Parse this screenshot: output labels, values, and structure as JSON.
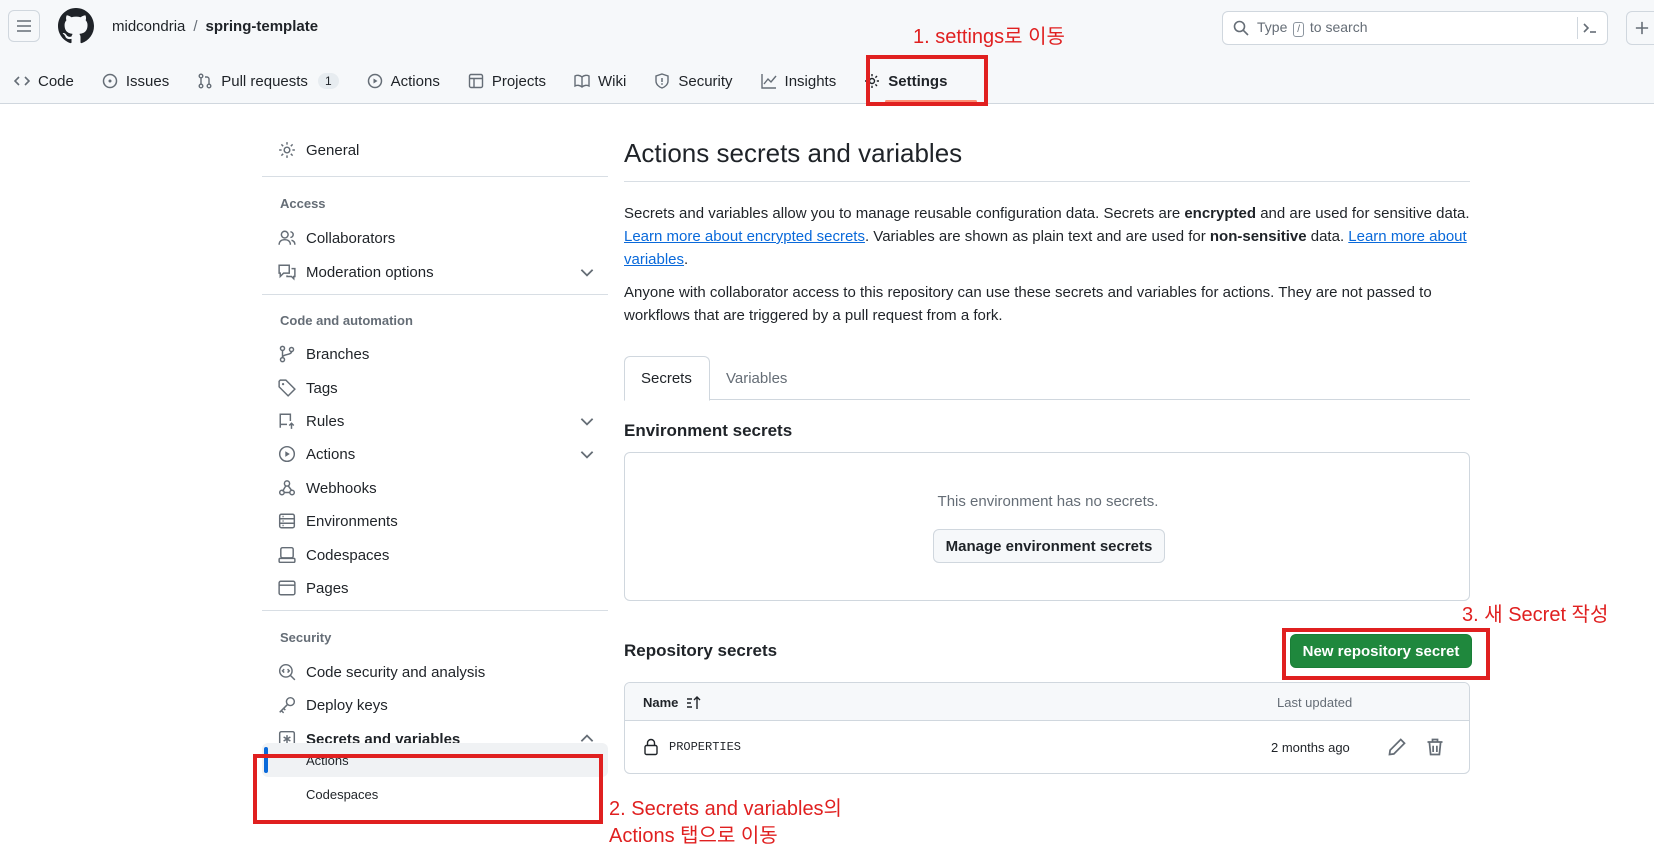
{
  "header": {
    "owner": "midcondria",
    "separator": "/",
    "repo": "spring-template",
    "search_before": "Type",
    "search_key": "/",
    "search_after": "to search"
  },
  "repo_nav": [
    {
      "label": "Code",
      "icon": "code-icon"
    },
    {
      "label": "Issues",
      "icon": "issue-icon"
    },
    {
      "label": "Pull requests",
      "icon": "pull-request-icon",
      "count": "1"
    },
    {
      "label": "Actions",
      "icon": "play-icon"
    },
    {
      "label": "Projects",
      "icon": "table-icon"
    },
    {
      "label": "Wiki",
      "icon": "book-icon"
    },
    {
      "label": "Security",
      "icon": "shield-icon"
    },
    {
      "label": "Insights",
      "icon": "graph-icon"
    },
    {
      "label": "Settings",
      "icon": "gear-icon",
      "selected": true
    }
  ],
  "annotations": {
    "step1": "1. settings로 이동",
    "step2_line1": "2. Secrets and variables의",
    "step2_line2": "Actions 탭으로 이동",
    "step3": "3. 새 Secret 작성"
  },
  "sidebar": {
    "general": "General",
    "access_heading": "Access",
    "collaborators": "Collaborators",
    "moderation": "Moderation options",
    "code_heading": "Code and automation",
    "branches": "Branches",
    "tags": "Tags",
    "rules": "Rules",
    "actions": "Actions",
    "webhooks": "Webhooks",
    "environments": "Environments",
    "codespaces": "Codespaces",
    "pages": "Pages",
    "security_heading": "Security",
    "code_security": "Code security and analysis",
    "deploy_keys": "Deploy keys",
    "secrets_variables": "Secrets and variables",
    "sub_actions": "Actions",
    "sub_codespaces": "Codespaces"
  },
  "main": {
    "title": "Actions secrets and variables",
    "p1_a": "Secrets and variables allow you to manage reusable configuration data. Secrets are ",
    "p1_b": "encrypted",
    "p1_c": " and are used for sensitive data. ",
    "p1_link1": "Learn more about encrypted secrets",
    "p1_d": ". Variables are shown as plain text and are used for ",
    "p1_e": "non-sensitive",
    "p1_f": " data. ",
    "p1_link2": "Learn more about variables",
    "p1_g": ".",
    "p2": "Anyone with collaborator access to this repository can use these secrets and variables for actions. They are not passed to workflows that are triggered by a pull request from a fork.",
    "tab_secrets": "Secrets",
    "tab_variables": "Variables",
    "env_heading": "Environment secrets",
    "env_empty": "This environment has no secrets.",
    "env_button": "Manage environment secrets",
    "repo_heading": "Repository secrets",
    "new_button": "New repository secret",
    "col_name": "Name",
    "col_updated": "Last updated",
    "rows": [
      {
        "name": "PROPERTIES",
        "updated": "2 months ago"
      }
    ]
  },
  "colors": {
    "accent": "#0969da",
    "primary_button": "#1f883d",
    "annotation": "#e02020",
    "selected_underline": "#fd8c73"
  }
}
